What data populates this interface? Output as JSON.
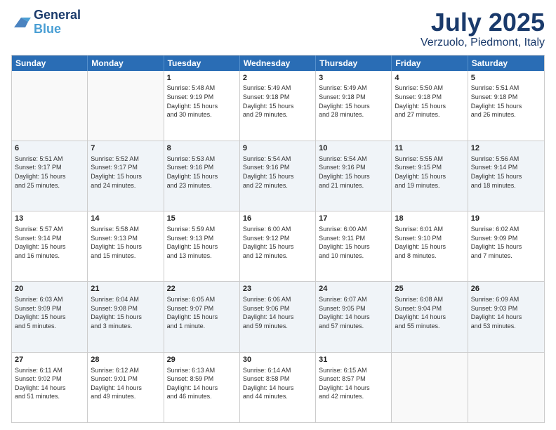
{
  "logo": {
    "line1": "General",
    "line2": "Blue"
  },
  "title": "July 2025",
  "subtitle": "Verzuolo, Piedmont, Italy",
  "header": {
    "days": [
      "Sunday",
      "Monday",
      "Tuesday",
      "Wednesday",
      "Thursday",
      "Friday",
      "Saturday"
    ]
  },
  "weeks": [
    {
      "altRow": false,
      "cells": [
        {
          "day": "",
          "content": ""
        },
        {
          "day": "",
          "content": ""
        },
        {
          "day": "1",
          "content": "Sunrise: 5:48 AM\nSunset: 9:19 PM\nDaylight: 15 hours\nand 30 minutes."
        },
        {
          "day": "2",
          "content": "Sunrise: 5:49 AM\nSunset: 9:18 PM\nDaylight: 15 hours\nand 29 minutes."
        },
        {
          "day": "3",
          "content": "Sunrise: 5:49 AM\nSunset: 9:18 PM\nDaylight: 15 hours\nand 28 minutes."
        },
        {
          "day": "4",
          "content": "Sunrise: 5:50 AM\nSunset: 9:18 PM\nDaylight: 15 hours\nand 27 minutes."
        },
        {
          "day": "5",
          "content": "Sunrise: 5:51 AM\nSunset: 9:18 PM\nDaylight: 15 hours\nand 26 minutes."
        }
      ]
    },
    {
      "altRow": true,
      "cells": [
        {
          "day": "6",
          "content": "Sunrise: 5:51 AM\nSunset: 9:17 PM\nDaylight: 15 hours\nand 25 minutes."
        },
        {
          "day": "7",
          "content": "Sunrise: 5:52 AM\nSunset: 9:17 PM\nDaylight: 15 hours\nand 24 minutes."
        },
        {
          "day": "8",
          "content": "Sunrise: 5:53 AM\nSunset: 9:16 PM\nDaylight: 15 hours\nand 23 minutes."
        },
        {
          "day": "9",
          "content": "Sunrise: 5:54 AM\nSunset: 9:16 PM\nDaylight: 15 hours\nand 22 minutes."
        },
        {
          "day": "10",
          "content": "Sunrise: 5:54 AM\nSunset: 9:16 PM\nDaylight: 15 hours\nand 21 minutes."
        },
        {
          "day": "11",
          "content": "Sunrise: 5:55 AM\nSunset: 9:15 PM\nDaylight: 15 hours\nand 19 minutes."
        },
        {
          "day": "12",
          "content": "Sunrise: 5:56 AM\nSunset: 9:14 PM\nDaylight: 15 hours\nand 18 minutes."
        }
      ]
    },
    {
      "altRow": false,
      "cells": [
        {
          "day": "13",
          "content": "Sunrise: 5:57 AM\nSunset: 9:14 PM\nDaylight: 15 hours\nand 16 minutes."
        },
        {
          "day": "14",
          "content": "Sunrise: 5:58 AM\nSunset: 9:13 PM\nDaylight: 15 hours\nand 15 minutes."
        },
        {
          "day": "15",
          "content": "Sunrise: 5:59 AM\nSunset: 9:13 PM\nDaylight: 15 hours\nand 13 minutes."
        },
        {
          "day": "16",
          "content": "Sunrise: 6:00 AM\nSunset: 9:12 PM\nDaylight: 15 hours\nand 12 minutes."
        },
        {
          "day": "17",
          "content": "Sunrise: 6:00 AM\nSunset: 9:11 PM\nDaylight: 15 hours\nand 10 minutes."
        },
        {
          "day": "18",
          "content": "Sunrise: 6:01 AM\nSunset: 9:10 PM\nDaylight: 15 hours\nand 8 minutes."
        },
        {
          "day": "19",
          "content": "Sunrise: 6:02 AM\nSunset: 9:09 PM\nDaylight: 15 hours\nand 7 minutes."
        }
      ]
    },
    {
      "altRow": true,
      "cells": [
        {
          "day": "20",
          "content": "Sunrise: 6:03 AM\nSunset: 9:09 PM\nDaylight: 15 hours\nand 5 minutes."
        },
        {
          "day": "21",
          "content": "Sunrise: 6:04 AM\nSunset: 9:08 PM\nDaylight: 15 hours\nand 3 minutes."
        },
        {
          "day": "22",
          "content": "Sunrise: 6:05 AM\nSunset: 9:07 PM\nDaylight: 15 hours\nand 1 minute."
        },
        {
          "day": "23",
          "content": "Sunrise: 6:06 AM\nSunset: 9:06 PM\nDaylight: 14 hours\nand 59 minutes."
        },
        {
          "day": "24",
          "content": "Sunrise: 6:07 AM\nSunset: 9:05 PM\nDaylight: 14 hours\nand 57 minutes."
        },
        {
          "day": "25",
          "content": "Sunrise: 6:08 AM\nSunset: 9:04 PM\nDaylight: 14 hours\nand 55 minutes."
        },
        {
          "day": "26",
          "content": "Sunrise: 6:09 AM\nSunset: 9:03 PM\nDaylight: 14 hours\nand 53 minutes."
        }
      ]
    },
    {
      "altRow": false,
      "cells": [
        {
          "day": "27",
          "content": "Sunrise: 6:11 AM\nSunset: 9:02 PM\nDaylight: 14 hours\nand 51 minutes."
        },
        {
          "day": "28",
          "content": "Sunrise: 6:12 AM\nSunset: 9:01 PM\nDaylight: 14 hours\nand 49 minutes."
        },
        {
          "day": "29",
          "content": "Sunrise: 6:13 AM\nSunset: 8:59 PM\nDaylight: 14 hours\nand 46 minutes."
        },
        {
          "day": "30",
          "content": "Sunrise: 6:14 AM\nSunset: 8:58 PM\nDaylight: 14 hours\nand 44 minutes."
        },
        {
          "day": "31",
          "content": "Sunrise: 6:15 AM\nSunset: 8:57 PM\nDaylight: 14 hours\nand 42 minutes."
        },
        {
          "day": "",
          "content": ""
        },
        {
          "day": "",
          "content": ""
        }
      ]
    }
  ]
}
